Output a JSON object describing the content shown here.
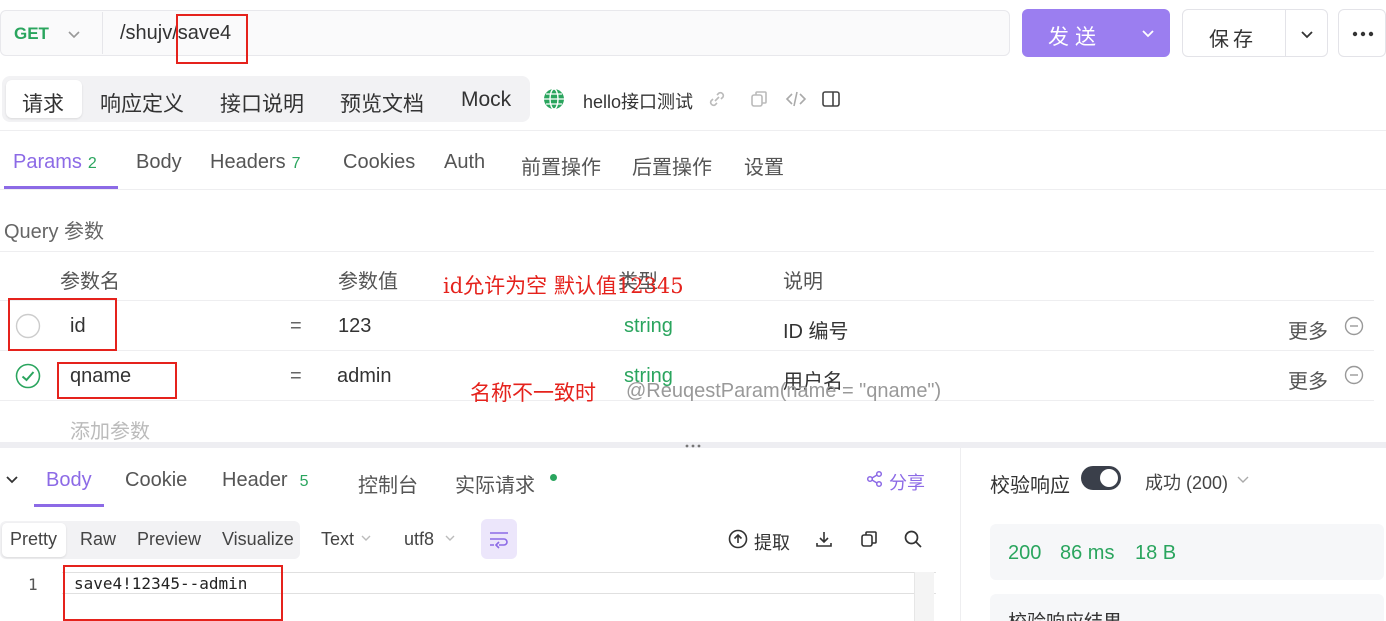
{
  "url_bar": {
    "method": "GET",
    "path": "/shujv/save4",
    "send_label": "发送",
    "save_label": "保存"
  },
  "top_tabs": [
    "请求",
    "响应定义",
    "接口说明",
    "预览文档",
    "Mock"
  ],
  "interface_name": "hello接口测试",
  "param_tabs": [
    {
      "label": "Params",
      "badge": "2"
    },
    {
      "label": "Body",
      "badge": ""
    },
    {
      "label": "Headers",
      "badge": "7"
    },
    {
      "label": "Cookies",
      "badge": ""
    },
    {
      "label": "Auth",
      "badge": ""
    },
    {
      "label": "前置操作",
      "badge": ""
    },
    {
      "label": "后置操作",
      "badge": ""
    },
    {
      "label": "设置",
      "badge": ""
    }
  ],
  "query": {
    "title": "Query 参数",
    "headers": {
      "name": "参数名",
      "value": "参数值",
      "type": "类型",
      "desc": "说明"
    },
    "rows": [
      {
        "name": "id",
        "eq": "=",
        "value": "123",
        "type": "string",
        "desc": "ID 编号",
        "more": "更多",
        "checked": false
      },
      {
        "name": "qname",
        "eq": "=",
        "value": "admin",
        "type": "string",
        "desc": "用户名",
        "more": "更多",
        "checked": true
      }
    ],
    "add_placeholder": "添加参数"
  },
  "annotations": {
    "id_note": "id允许为空 默认值12345",
    "name_note": "名称不一致时",
    "code_note": "@ReuqestParam(name = \"qname\")"
  },
  "response": {
    "tabs": [
      {
        "label": "Body",
        "badge": ""
      },
      {
        "label": "Cookie",
        "badge": ""
      },
      {
        "label": "Header",
        "badge": "5"
      },
      {
        "label": "控制台",
        "badge": ""
      },
      {
        "label": "实际请求",
        "badge": ""
      }
    ],
    "share_label": "分享",
    "formats": [
      "Pretty",
      "Raw",
      "Preview",
      "Visualize"
    ],
    "text_select": "Text",
    "encoding_select": "utf8",
    "extract_label": "提取",
    "line_number": "1",
    "body_text": "save4!12345--admin"
  },
  "verify": {
    "label": "校验响应",
    "toggle_on": true,
    "status_select": "成功 (200)",
    "status_code": "200",
    "time": "86 ms",
    "size": "18 B",
    "result_title": "校验响应结果"
  },
  "colors": {
    "accent": "#8c6ae6",
    "send_button": "#9b7ef0",
    "green": "#2aa55e",
    "annotation_red": "#e5221c"
  },
  "icons": [
    "chevron-down-icon",
    "more-dots-icon",
    "globe-icon",
    "link-icon",
    "copy-icon",
    "code-icon",
    "panel-icon",
    "check-circle-icon",
    "remove-circle-icon",
    "share-icon",
    "wrap-icon",
    "extract-icon",
    "download-icon",
    "search-icon"
  ]
}
